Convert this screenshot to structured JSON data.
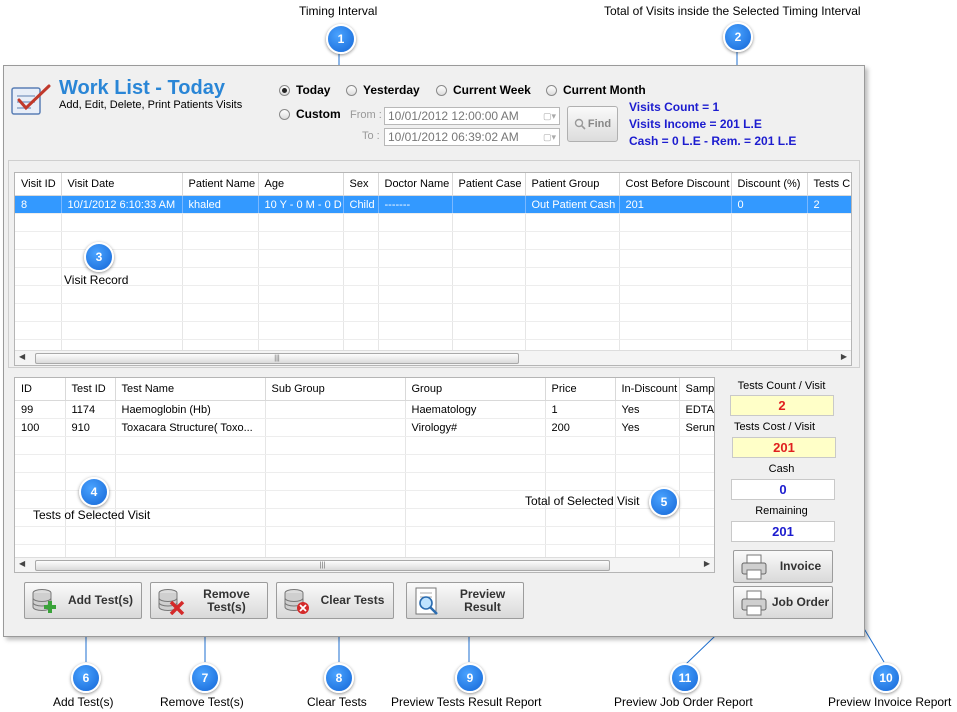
{
  "annotations": {
    "timing_interval": "Timing Interval",
    "total_visits": "Total of Visits inside the Selected Timing Interval",
    "visit_record": "Visit Record",
    "tests_selected": "Tests of Selected Visit",
    "total_selected": "Total of Selected Visit",
    "add_tests": "Add Test(s)",
    "remove_tests": "Remove Test(s)",
    "clear_tests": "Clear Tests",
    "preview_tests": "Preview Tests Result Report",
    "preview_job": "Preview Job Order Report",
    "preview_invoice": "Preview Invoice Report",
    "badges": [
      "1",
      "2",
      "3",
      "4",
      "5",
      "6",
      "7",
      "8",
      "9",
      "10",
      "11"
    ]
  },
  "header": {
    "title": "Work List - Today",
    "subtitle": "Add, Edit, Delete, Print Patients Visits"
  },
  "filters": {
    "today": "Today",
    "yesterday": "Yesterday",
    "current_week": "Current Week",
    "current_month": "Current Month",
    "custom": "Custom",
    "from_label": "From :",
    "to_label": "To :",
    "from_value": "10/01/2012 12:00:00 AM",
    "to_value": "10/01/2012 06:39:02 AM",
    "find": "Find",
    "selected": "Today"
  },
  "stats": {
    "visits_count": "Visits Count = 1",
    "visits_income": "Visits Income = 201 L.E",
    "cash": "Cash = 0 L.E - Rem. = 201 L.E"
  },
  "visits_table": {
    "columns": [
      "Visit ID",
      "Visit Date",
      "Patient Name",
      "Age",
      "Sex",
      "Doctor Name",
      "Patient Case",
      "Patient Group",
      "Cost Before Discount",
      "Discount (%)",
      "Tests C"
    ],
    "rows": [
      [
        "8",
        "10/1/2012 6:10:33 AM",
        "khaled",
        "10 Y - 0 M - 0 D",
        "Child",
        "-------",
        "",
        "Out Patient Cash",
        "201",
        "0",
        "2"
      ]
    ]
  },
  "tests_table": {
    "columns": [
      "ID",
      "Test ID",
      "Test Name",
      "Sub Group",
      "Group",
      "Price",
      "In-Discount",
      "Samp"
    ],
    "rows": [
      [
        "99",
        "1174",
        "Haemoglobin (Hb)",
        "",
        "Haematology",
        "1",
        "Yes",
        "EDTA"
      ],
      [
        "100",
        "910",
        "Toxacara Structure( Toxo...",
        "",
        "Virology#",
        "200",
        "Yes",
        "Serum"
      ]
    ]
  },
  "totals": {
    "tests_count_label": "Tests Count / Visit",
    "tests_count": "2",
    "tests_cost_label": "Tests Cost / Visit",
    "tests_cost": "201",
    "cash_label": "Cash",
    "cash": "0",
    "remaining_label": "Remaining",
    "remaining": "201"
  },
  "buttons": {
    "add": "Add Test(s)",
    "remove": "Remove Test(s)",
    "clear": "Clear Tests",
    "preview": "Preview Result",
    "invoice": "Invoice",
    "job_order": "Job Order"
  },
  "colors": {
    "title": "#2a86d6",
    "selection": "#3399ff",
    "stats_text": "#1c1ccf",
    "badge": "#1466d6"
  }
}
